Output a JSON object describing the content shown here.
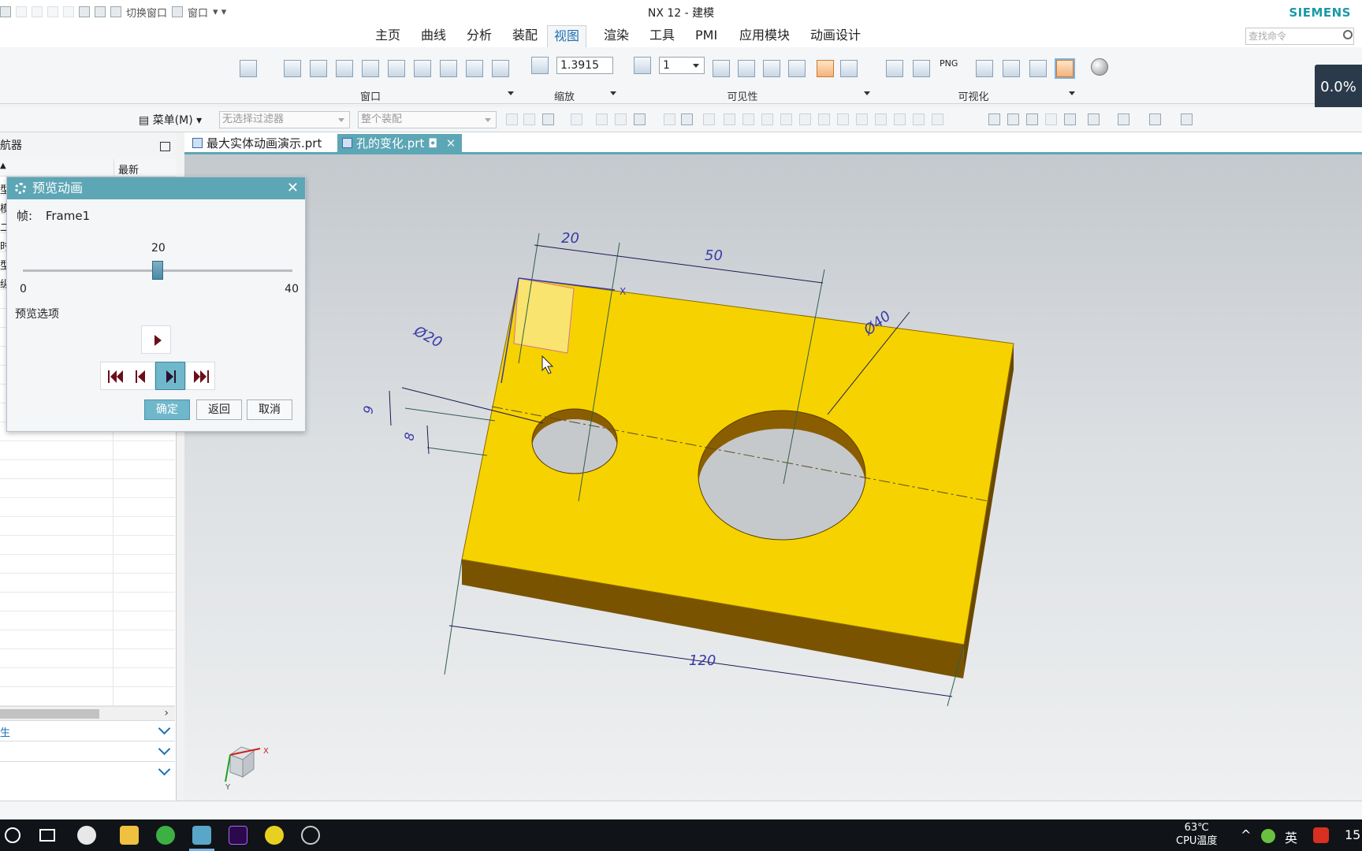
{
  "window": {
    "title": "NX 12 - 建模",
    "brand": "SIEMENS"
  },
  "quick_access": {
    "switch_window": "切换窗口",
    "window_menu": "窗口"
  },
  "ribbon_tabs": [
    "主页",
    "曲线",
    "分析",
    "装配",
    "视图",
    "渲染",
    "工具",
    "PMI",
    "应用模块",
    "动画设计"
  ],
  "active_tab": "视图",
  "search": {
    "placeholder": "查找命令"
  },
  "ribbon": {
    "groups": [
      "窗口",
      "缩放",
      "可见性",
      "可视化"
    ],
    "zoom_value": "1.3915",
    "layer_value": "1",
    "png_label": "PNG"
  },
  "progress": {
    "text": "0.0%"
  },
  "filterbar": {
    "menu_label": "菜单(M)",
    "type_filter_placeholder": "无选择过滤器",
    "scope_placeholder": "整个装配"
  },
  "navigator": {
    "title": "航器",
    "column_latest": "最新",
    "row_fragments": [
      "型",
      "模",
      "二",
      "时",
      "型",
      "纵"
    ],
    "section_1": "生"
  },
  "doc_tabs": [
    {
      "label": "最大实体动画演示.prt",
      "active": false
    },
    {
      "label": "孔的变化.prt",
      "active": true
    }
  ],
  "drawing": {
    "dim_top_left": "20",
    "dim_top_right": "50",
    "dim_hole_small": "Ø20",
    "dim_hole_large": "Ø40",
    "dim_side_a": "9",
    "dim_side_b": "8",
    "dim_bottom": "120",
    "axis_x": "X",
    "axis_y": "Y"
  },
  "dialog": {
    "title": "预览动画",
    "frame_label": "帧:",
    "frame_value": "Frame1",
    "slider_value": 20,
    "slider_value_text": "20",
    "slider_min": "0",
    "slider_max": "40",
    "options_label": "预览选项",
    "buttons": {
      "ok": "确定",
      "back": "返回",
      "cancel": "取消"
    }
  },
  "taskbar": {
    "temperature": "63℃",
    "temp_label": "CPU温度",
    "ime": "英",
    "clock_fragment": "15"
  },
  "colors": {
    "accent": "#5ca6b5",
    "part_yellow": "#f6d200",
    "part_side": "#7a5300",
    "dim_blue": "#3a3aa8"
  }
}
